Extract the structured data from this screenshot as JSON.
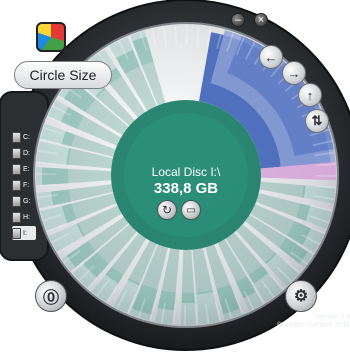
{
  "window": {
    "minimize": "–",
    "close": "×"
  },
  "app": {
    "title": "Circle Size",
    "version": "Version 3.8",
    "copyright": "© Steffen Gerlach 2010"
  },
  "center": {
    "label": "Local Disc I:\\",
    "size": "338,8 GB"
  },
  "drives": [
    {
      "letter": "C:"
    },
    {
      "letter": "D:"
    },
    {
      "letter": "E:"
    },
    {
      "letter": "F:"
    },
    {
      "letter": "G:"
    },
    {
      "letter": "H:"
    },
    {
      "letter": "I:"
    }
  ],
  "icons": {
    "back": "arrow-left-icon",
    "forward": "arrow-right-icon",
    "up": "arrow-up-icon",
    "swap": "swap-icon",
    "settings": "gear-icon",
    "refresh": "refresh-icon",
    "open": "open-folder-icon",
    "info": "info-icon",
    "logo": "disc-logo-icon"
  },
  "colors": {
    "teal": "#2f9e86",
    "teal_light": "#8fd3c0",
    "teal_dark": "#1f7f69",
    "blue": "#3f63b8",
    "blue_light": "#8fa3d6",
    "pink": "#d6a1d8"
  }
}
